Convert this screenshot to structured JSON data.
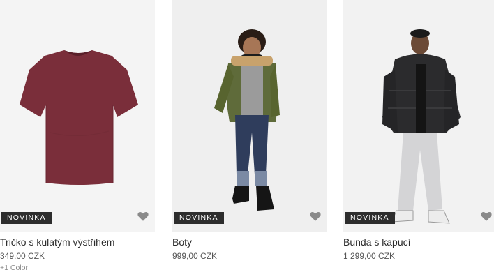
{
  "products": [
    {
      "badge": "NOVINKA",
      "title": "Tričko s kulatým výstřihem",
      "price": "349,00 CZK",
      "extra": "+1 Color",
      "image_icon": "t-shirt-image",
      "color": "#7a2e3a"
    },
    {
      "badge": "NOVINKA",
      "title": "Boty",
      "price": "999,00 CZK",
      "image_icon": "model-bomber-jacket-image",
      "color": "#5f6b3a"
    },
    {
      "badge": "NOVINKA",
      "title": "Bunda s kapucí",
      "price": "1 299,00 CZK",
      "image_icon": "model-puffer-jacket-image",
      "color": "#2b2b2d"
    }
  ],
  "icons": {
    "favorite": "heart-icon"
  }
}
